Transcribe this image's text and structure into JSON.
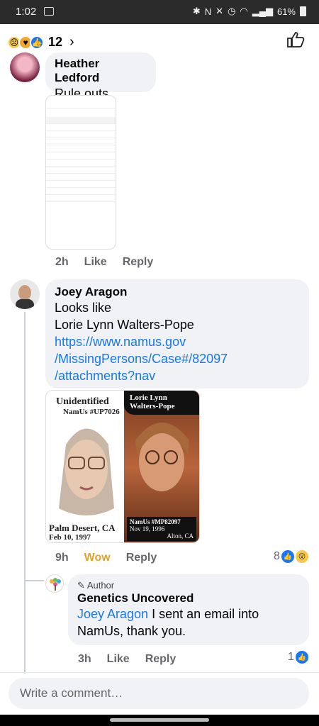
{
  "status": {
    "time": "1:02",
    "battery": "61%"
  },
  "header": {
    "reaction_count": "12"
  },
  "comments": [
    {
      "name": "Heather Ledford",
      "text": "Rule outs",
      "time": "2h",
      "like": "Like",
      "reply": "Reply"
    },
    {
      "name": "Joey Aragon",
      "line1": "Looks like",
      "line2": "Lorie Lynn Walters-Pope",
      "link1": "https://www.namus.gov",
      "link2": "/MissingPersons/Case#/82097",
      "link3": "/attachments?nav",
      "time": "9h",
      "reaction": "Wow",
      "reply": "Reply",
      "reaction_count": "8"
    },
    {
      "badge": "Author",
      "name": "Genetics Uncovered",
      "mention": "Joey Aragon",
      "text1": " I sent an email into",
      "text2": "NamUs, thank you.",
      "time": "3h",
      "like": "Like",
      "reply": "Reply",
      "reaction_count": "1"
    }
  ],
  "photo": {
    "left_title": "Unidentified",
    "left_sub": "NamUs #UP7026",
    "left_place": "Palm Desert, CA",
    "left_date": "Feb 10, 1997",
    "right_title1": "Lorie Lynn",
    "right_title2": "Walters-Pope",
    "right_case": "NamUs #MP82097",
    "right_date": "Nov 19, 1996",
    "right_place": "Alton, CA"
  },
  "composer": {
    "placeholder": "Write a comment…"
  }
}
